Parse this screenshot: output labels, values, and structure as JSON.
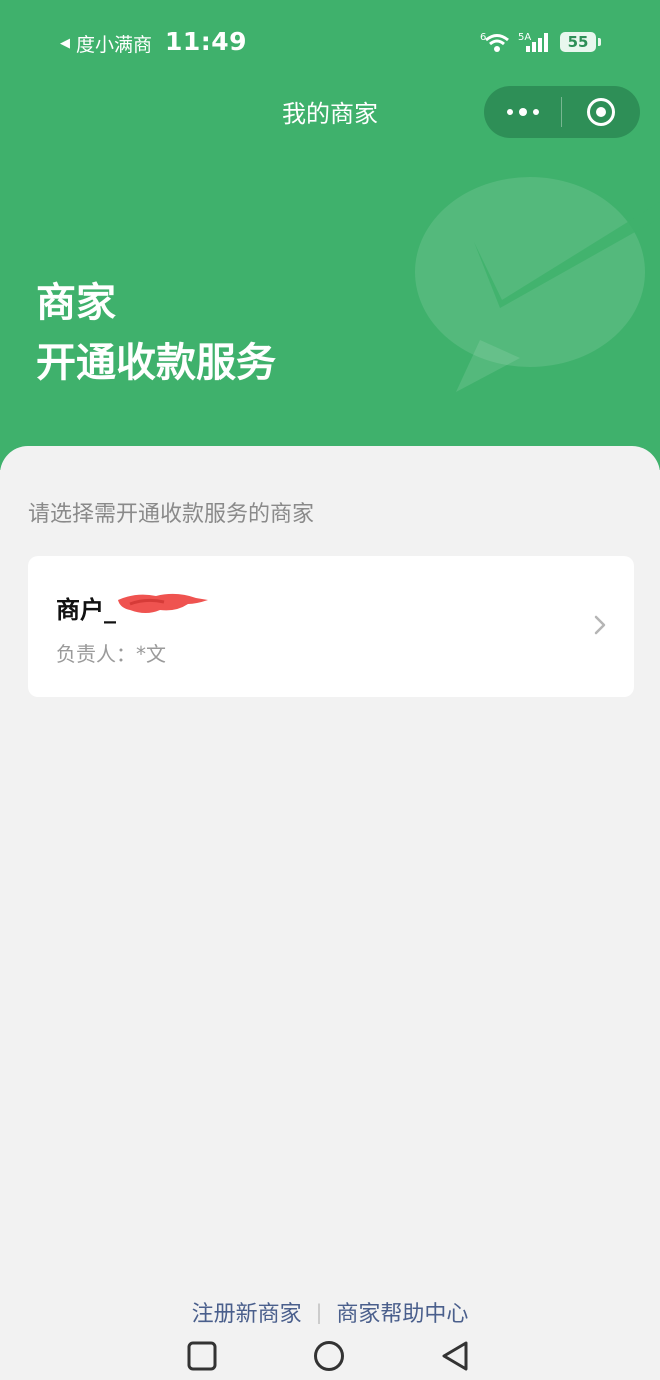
{
  "status_bar": {
    "back_app": "度小满商",
    "time": "11:49",
    "network_wifi": "6",
    "network_cell": "5A",
    "battery": "55"
  },
  "nav": {
    "title": "我的商家"
  },
  "hero": {
    "line1": "商家",
    "line2": "开通收款服务"
  },
  "content": {
    "prompt": "请选择需开通收款服务的商家",
    "merchants": [
      {
        "name": "商户_",
        "owner": "负责人：*文"
      }
    ]
  },
  "footer": {
    "register": "注册新商家",
    "divider": "|",
    "help": "商家帮助中心"
  },
  "colors": {
    "brand_green": "#3fb16c",
    "capsule_green": "#2e8f57",
    "link_blue": "#4a5f8c"
  }
}
